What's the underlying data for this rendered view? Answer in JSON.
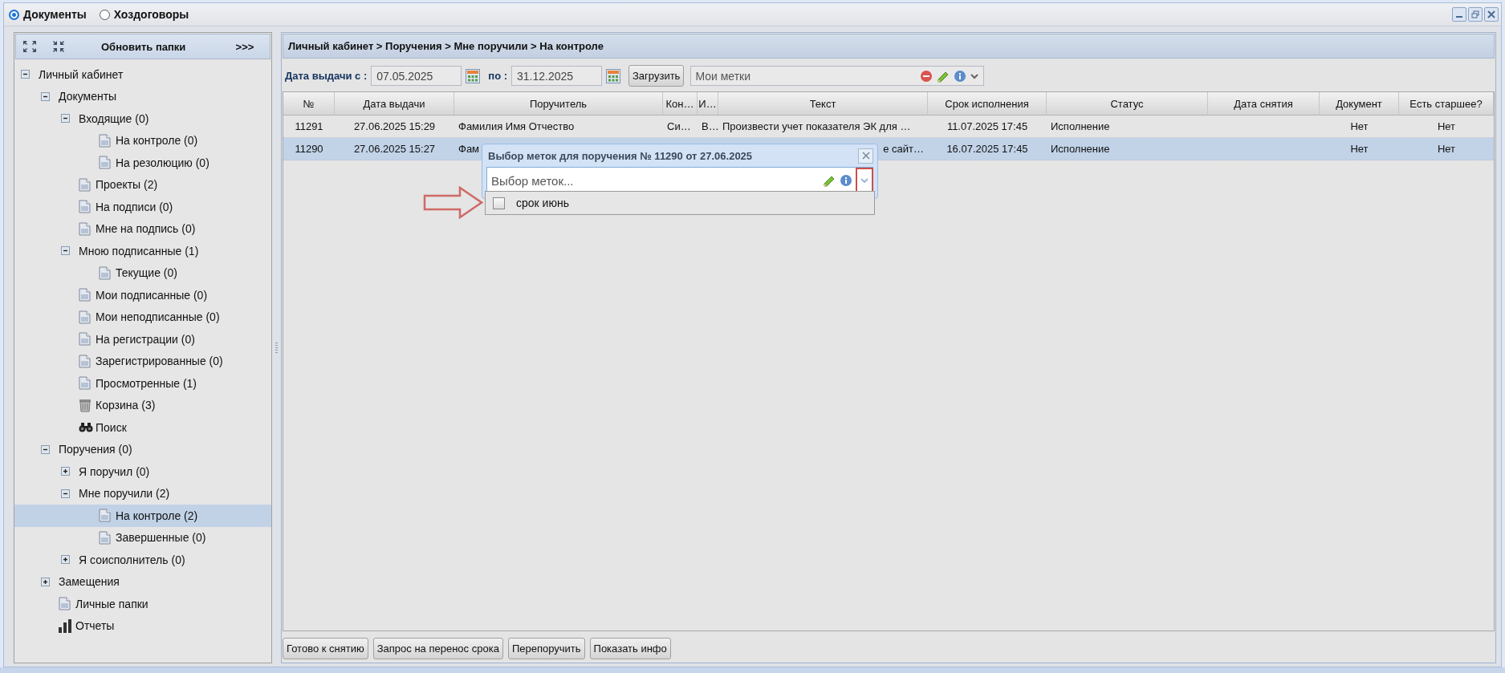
{
  "window": {
    "options": [
      {
        "label": "Документы",
        "selected": true
      },
      {
        "label": "Хоздоговоры",
        "selected": false
      }
    ]
  },
  "sidebar": {
    "refresh_label": "Обновить папки",
    "more_label": ">>>",
    "tree": [
      {
        "label": "Личный кабинет",
        "expanded": true,
        "selected": false,
        "children": [
          {
            "label": "Документы",
            "expanded": true,
            "selected": false,
            "children": [
              {
                "label": "Входящие (0)",
                "expanded": true,
                "selected": false,
                "children": [
                  {
                    "label": "На контроле (0)",
                    "kind": "doc",
                    "selected": false
                  },
                  {
                    "label": "На резолюцию (0)",
                    "kind": "doc",
                    "selected": false
                  }
                ]
              },
              {
                "label": "Проекты (2)",
                "kind": "doc",
                "selected": false
              },
              {
                "label": "На подписи (0)",
                "kind": "doc",
                "selected": false
              },
              {
                "label": "Мне на подпись (0)",
                "kind": "doc",
                "selected": false
              },
              {
                "label": "Мною подписанные (1)",
                "expanded": true,
                "selected": false,
                "children": [
                  {
                    "label": "Текущие (0)",
                    "kind": "doc",
                    "selected": false
                  }
                ]
              },
              {
                "label": "Мои подписанные (0)",
                "kind": "doc",
                "selected": false
              },
              {
                "label": "Мои неподписанные (0)",
                "kind": "doc",
                "selected": false
              },
              {
                "label": "На регистрации (0)",
                "kind": "doc",
                "selected": false
              },
              {
                "label": "Зарегистрированные (0)",
                "kind": "doc",
                "selected": false
              },
              {
                "label": "Просмотренные (1)",
                "kind": "doc",
                "selected": false
              },
              {
                "label": "Корзина (3)",
                "kind": "trash",
                "selected": false
              },
              {
                "label": "Поиск",
                "kind": "search",
                "selected": false
              }
            ]
          },
          {
            "label": "Поручения (0)",
            "expanded": true,
            "selected": false,
            "children": [
              {
                "label": "Я поручил (0)",
                "expanded": false,
                "selected": false
              },
              {
                "label": "Мне поручили (2)",
                "expanded": true,
                "selected": false,
                "children": [
                  {
                    "label": "На контроле (2)",
                    "kind": "doc",
                    "selected": true
                  },
                  {
                    "label": "Завершенные (0)",
                    "kind": "doc",
                    "selected": false
                  }
                ]
              },
              {
                "label": "Я соисполнитель (0)",
                "expanded": false,
                "selected": false
              }
            ]
          },
          {
            "label": "Замещения",
            "expanded": false,
            "selected": false
          },
          {
            "label": "Личные папки",
            "kind": "doc",
            "selected": false
          },
          {
            "label": "Отчеты",
            "kind": "chart",
            "selected": false
          }
        ]
      }
    ]
  },
  "breadcrumb": "Личный кабинет > Поручения > Мне поручили > На контроле",
  "filter": {
    "date_from_label": "Дата выдачи с :",
    "date_from": "07.05.2025",
    "date_to_label": "по :",
    "date_to": "31.12.2025",
    "load_button": "Загрузить",
    "tags_placeholder": "Мои метки"
  },
  "table": {
    "columns": [
      "№",
      "Дата выдачи",
      "Поручитель",
      "Кон…",
      "И…",
      "Текст",
      "Срок исполнения",
      "Статус",
      "Дата снятия",
      "Документ",
      "Есть старшее?"
    ],
    "rows": [
      {
        "selected": false,
        "covered": false,
        "cells": [
          "11291",
          "27.06.2025 15:29",
          "Фамилия Имя Отчество",
          "Си…",
          "В…",
          "Произвести учет показателя ЭК для …",
          "11.07.2025 17:45",
          "Исполнение",
          null,
          "Нет",
          "Нет"
        ]
      },
      {
        "selected": true,
        "covered": true,
        "cells": [
          "11290",
          "27.06.2025 15:27",
          "Фам",
          null,
          null,
          "е сайт…",
          "16.07.2025 17:45",
          "Исполнение",
          null,
          "Нет",
          "Нет"
        ]
      }
    ]
  },
  "popup": {
    "title": "Выбор меток для поручения № 11290 от 27.06.2025",
    "placeholder": "Выбор меток...",
    "trigger_highlighted": true,
    "options": [
      {
        "label": "срок июнь",
        "checked": false
      }
    ]
  },
  "buttons": [
    "Готово к снятию",
    "Запрос на перенос срока",
    "Перепоручить",
    "Показать инфо"
  ]
}
